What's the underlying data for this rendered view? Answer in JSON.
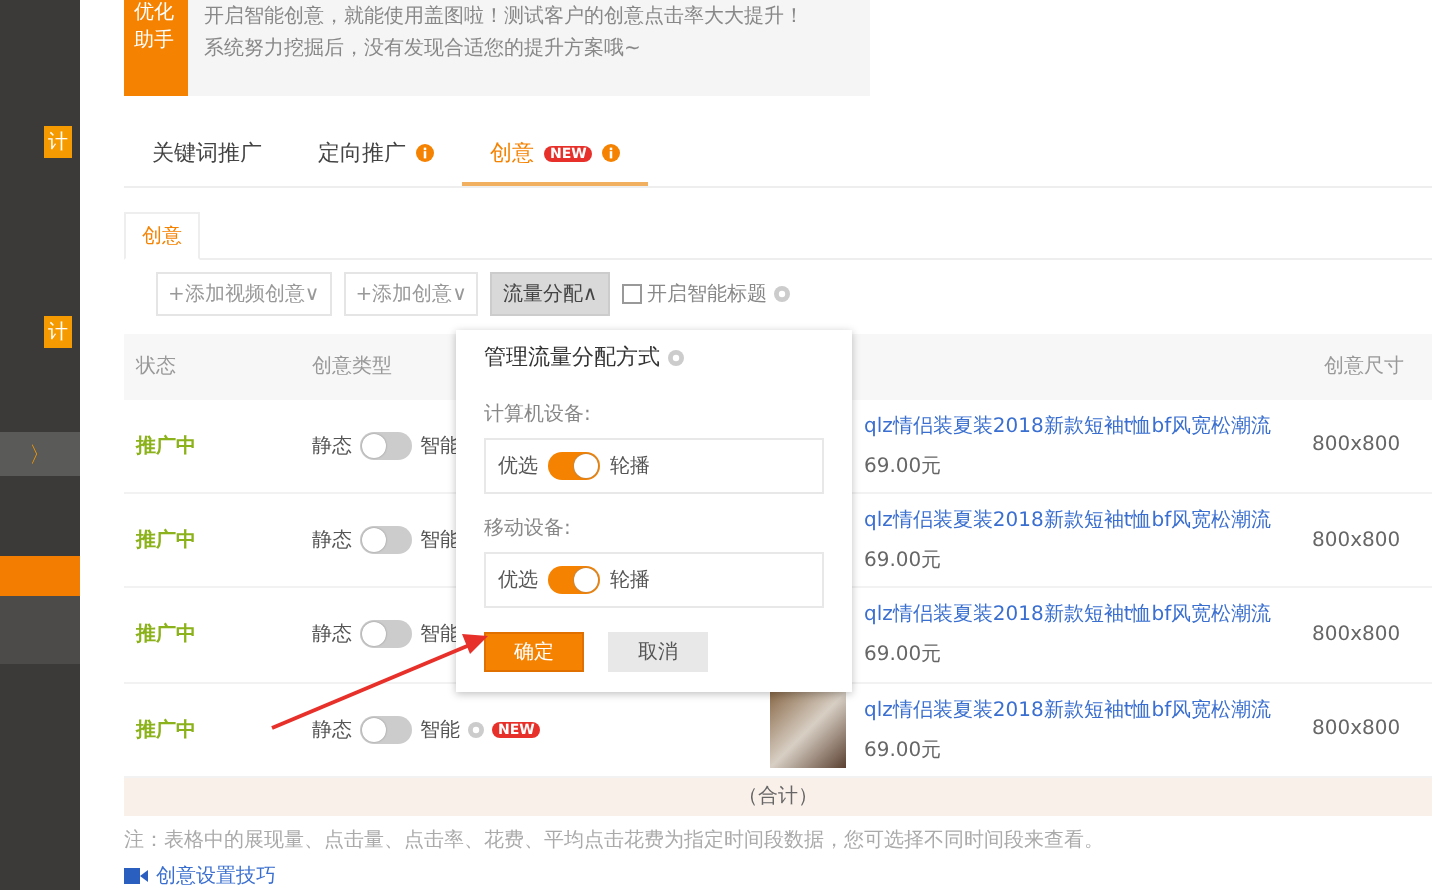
{
  "sidebar": {
    "items": [
      {
        "kind": "badge",
        "label": "计"
      },
      {
        "kind": "badge",
        "label": "计"
      },
      {
        "kind": "arrow",
        "label": "〉"
      },
      {
        "kind": "active"
      },
      {
        "kind": "plain"
      }
    ]
  },
  "banner": {
    "badge": "优化助手",
    "lines": [
      "开启智能创意，就能使用盖图啦！测试客户的创意点击率大大提升！",
      "系统努力挖掘后，没有发现合适您的提升方案哦~"
    ]
  },
  "tabs": [
    {
      "label": "关键词推广",
      "selected": false,
      "info": false
    },
    {
      "label": "定向推广",
      "selected": false,
      "info": true
    },
    {
      "label": "创意",
      "selected": true,
      "info": true,
      "new_badge": "NEW"
    }
  ],
  "subtabs": [
    {
      "label": "创意",
      "selected": true
    }
  ],
  "toolbar": {
    "buttons": [
      {
        "label": "+添加视频创意∨",
        "pressed": false
      },
      {
        "label": "+添加创意∨",
        "pressed": false
      },
      {
        "label": "流量分配∧",
        "pressed": true
      }
    ],
    "smart_title": {
      "label": "开启智能标题",
      "checked": false
    }
  },
  "table": {
    "columns": [
      "状态",
      "创意类型",
      "",
      "",
      "创意尺寸"
    ],
    "rows": [
      {
        "status": "推广中",
        "static_label": "静态",
        "smart_on": false,
        "smart_label": "智能",
        "has_image": false,
        "title": "qlz情侣装夏装2018新款短袖t恤bf风宽松潮流",
        "price": "69.00元",
        "size": "800x800"
      },
      {
        "status": "推广中",
        "static_label": "静态",
        "smart_on": false,
        "smart_label": "智能",
        "has_image": false,
        "title": "qlz情侣装夏装2018新款短袖t恤bf风宽松潮流",
        "price": "69.00元",
        "size": "800x800"
      },
      {
        "status": "推广中",
        "static_label": "静态",
        "smart_on": false,
        "smart_label": "智能",
        "has_image": false,
        "title": "qlz情侣装夏装2018新款短袖t恤bf风宽松潮流",
        "price": "69.00元",
        "size": "800x800"
      },
      {
        "status": "推广中",
        "static_label": "静态",
        "smart_on": false,
        "smart_label": "智能",
        "new_badge": "NEW",
        "has_image": true,
        "title": "qlz情侣装夏装2018新款短袖t恤bf风宽松潮流",
        "price": "69.00元",
        "size": "800x800"
      }
    ],
    "total": "（合计）"
  },
  "note": "注：表格中的展现量、点击量、点击率、花费、平均点击花费为指定时间段数据，您可选择不同时间段来查看。",
  "tips_link": "创意设置技巧",
  "popup": {
    "title": "管理流量分配方式",
    "groups": [
      {
        "label": "计算机设备:",
        "left": "优选",
        "right": "轮播",
        "on": true
      },
      {
        "label": "移动设备:",
        "left": "优选",
        "right": "轮播",
        "on": true
      }
    ],
    "confirm": "确定",
    "cancel": "取消"
  }
}
